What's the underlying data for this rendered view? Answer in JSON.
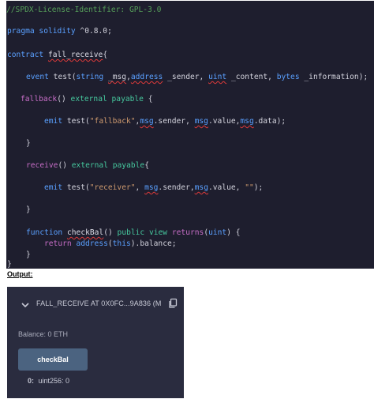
{
  "editor": {
    "lines": [
      "//SPDX-License-Identifier: GPL-3.0",
      "pragma solidity ^0.8.0;",
      "contract fall_receive{",
      "event test(string _msg,address _sender, uint _content, bytes _information);",
      "fallback() external payable {",
      "emit test(\"fallback\",msg.sender, msg.value,msg.data);",
      "}",
      "receive() external payable{",
      "emit test(\"receiver\", msg.sender,msg.value, \"\");",
      "}",
      "function checkBal() public view returns(uint) {",
      "return address(this).balance;",
      "}",
      "}"
    ]
  },
  "output_label": "Output:",
  "deployed_contract": {
    "name": "FALL_RECEIVE AT 0X0FC...9A836 (M",
    "balance": "Balance: 0 ETH",
    "function_button": "checkBal",
    "result_index": "0:",
    "result_value": "uint256: 0"
  },
  "icons": {
    "expand": "chevron-down-icon",
    "copy": "copy-icon"
  },
  "colors": {
    "editor_background": "#1e1e2e",
    "panel_background": "#2a2c3f",
    "button_background": "#4b6380",
    "comment": "#56a05a",
    "keyword": "#5aa0ff",
    "function_keyword": "#c86ec8",
    "string": "#ce9a6e"
  }
}
